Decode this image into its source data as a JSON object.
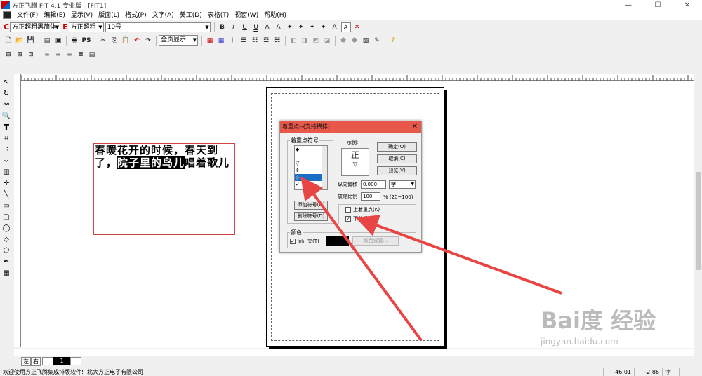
{
  "app": {
    "title": "方正飞腾 FIT 4.1 专业版 - [FIT1]"
  },
  "window_buttons": [
    "—",
    "☐",
    "✕"
  ],
  "menu": [
    "文件(F)",
    "编辑(E)",
    "显示(V)",
    "版面(L)",
    "格式(P)",
    "文字(A)",
    "美工(D)",
    "表格(T)",
    "视窗(W)",
    "帮助(H)"
  ],
  "toolbar1": {
    "c_letter": "C",
    "chinese_font": "方正超粗黑简体",
    "e_letter": "E",
    "english_font": "方正超粗",
    "font_size": "10号",
    "format_buttons": [
      "B",
      "I",
      "U",
      "U",
      "A",
      "A",
      "✦",
      "✦",
      "✦",
      "✦",
      "A",
      "A",
      "✕"
    ]
  },
  "toolbar2": {
    "view_select": "全页显示",
    "ps_label": "PS"
  },
  "poem": {
    "line1": "春暖花开的时候，春天到",
    "line2_start": "了，",
    "line2_highlight": "院子里的鸟儿",
    "line2_end": "唱着歌儿"
  },
  "dialog": {
    "title": "着重点--(支持横排)",
    "close": "✕",
    "symbol_group": "着重点符号",
    "list_items": [
      "◆",
      "",
      "▽",
      "↕",
      "◇",
      "✓"
    ],
    "example_label": "示例:",
    "preview_glyph_top": "正",
    "preview_glyph_bottom": "▽",
    "btn_ok": "确定(O)",
    "btn_cancel": "取消(C)",
    "btn_preview": "预览(V)",
    "add_symbol": "添加符号(N)",
    "delete_symbol": "删除符号(D)",
    "offset_label": "纵向偏移",
    "offset_value": "0.000",
    "offset_unit": "字",
    "scale_label": "放缩比例",
    "scale_value": "100",
    "scale_hint": "% (20~100)",
    "top_label": "上着重点(K)",
    "bottom_label": "下着重点(L)",
    "bottom_checked": "✓",
    "color_group": "颜色",
    "same_text_label": "同正文(T)",
    "same_text_checked": "✓",
    "color_settings": "颜色设置..."
  },
  "pagebar": {
    "left": "左",
    "right": "右",
    "page": "1"
  },
  "status": {
    "welcome": "欢迎使用方正飞腾集成排版软件!",
    "company": "北大方正电子有限公司",
    "x": "-46.01",
    "y": "-2.86",
    "unit": "字"
  },
  "watermark": {
    "brand": "Bai度 经验",
    "url": "jingyan.baidu.com"
  },
  "colors": {
    "dialog_title": "#e8584a",
    "arrow": "#e84545",
    "selection": "#1a6fc4"
  }
}
